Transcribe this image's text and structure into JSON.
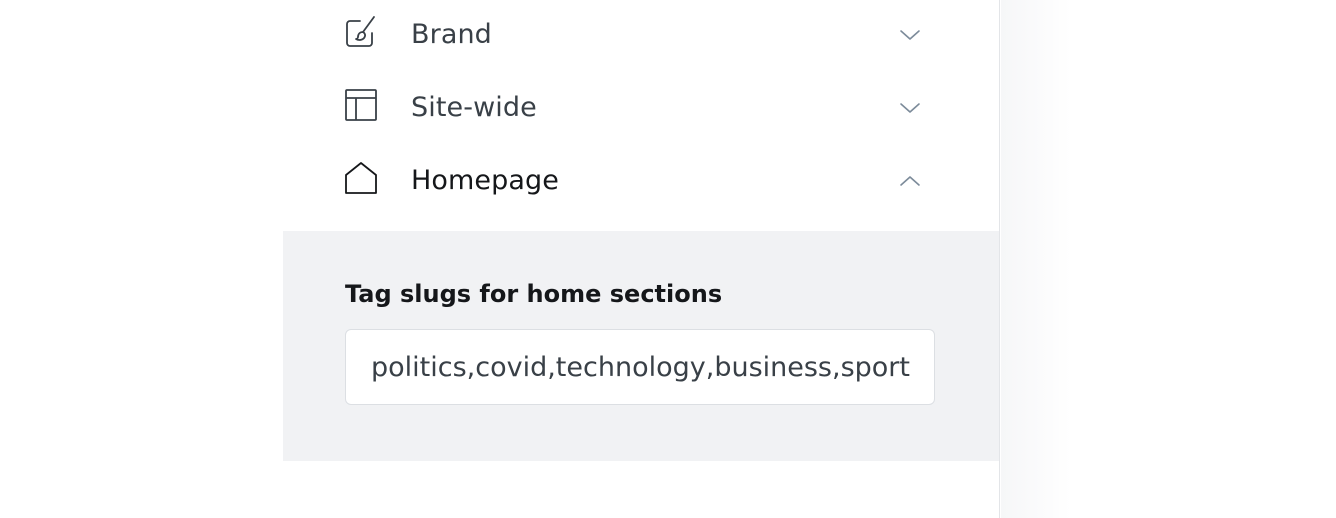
{
  "settings": {
    "sections": [
      {
        "label": "Brand",
        "icon": "paintbrush-icon",
        "state": "collapsed"
      },
      {
        "label": "Site-wide",
        "icon": "layout-icon",
        "state": "collapsed"
      },
      {
        "label": "Homepage",
        "icon": "home-icon",
        "state": "expanded"
      }
    ],
    "homepage": {
      "field_label": "Tag slugs for home sections",
      "field_value": "politics,covid,technology,business,sports"
    }
  },
  "colors": {
    "text_primary": "#15171a",
    "text_secondary": "#394047",
    "expanded_background": "#f1f2f4",
    "border": "#dcdfe3"
  }
}
